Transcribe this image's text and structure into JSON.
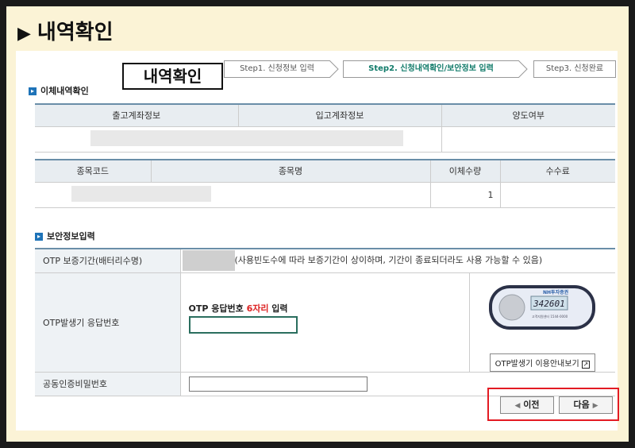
{
  "page": {
    "heading": "내역확인",
    "highlight_label": "내역확인"
  },
  "steps": [
    {
      "label": "Step1. 신청정보 입력",
      "active": false
    },
    {
      "label": "Step2. 신청내역확인/보안정보 입력",
      "active": true
    },
    {
      "label": "Step3. 신청완료",
      "active": false
    }
  ],
  "transfer": {
    "section_title": "이체내역확인",
    "headers": [
      "출고계좌정보",
      "입고계좌정보",
      "양도여부"
    ]
  },
  "stock": {
    "headers": [
      "종목코드",
      "종목명",
      "이체수량",
      "수수료"
    ],
    "quantity": "1"
  },
  "security": {
    "section_title": "보안정보입력",
    "otp_period_label": "OTP 보증기간(배터리수명)",
    "otp_period_note": "(사용빈도수에 따라 보증기간이 상이하며, 기간이 종료되더라도 사용 가능할 수 있음)",
    "otp_response_label": "OTP발생기 응답번호",
    "otp_prompt_prefix": "OTP 응답번호 ",
    "otp_prompt_highlight": "6자리",
    "otp_prompt_suffix": " 입력",
    "otp_device_brand": "NH투자증권",
    "otp_device_number": "342601",
    "otp_device_footer": "고객지원센터 1544-0000",
    "otp_guide_button": "OTP발생기 이용안내보기",
    "cert_password_label": "공동인증비밀번호"
  },
  "nav": {
    "prev_label": "이전",
    "next_label": "다음"
  },
  "colors": {
    "accent_green": "#117b6a",
    "highlight_red": "#e31b23",
    "header_blue": "#6a8ea8"
  }
}
